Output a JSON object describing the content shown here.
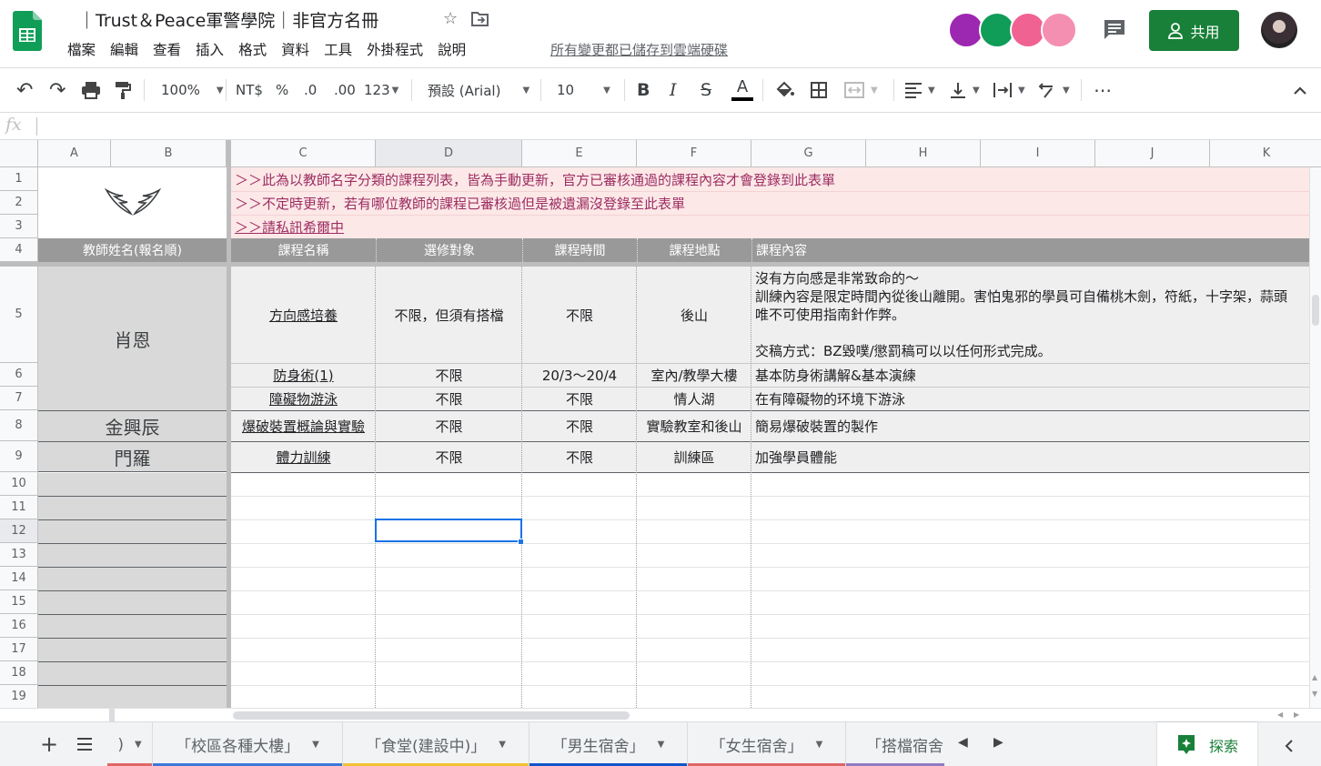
{
  "app": {
    "title": "｜Trust＆Peace軍警學院｜非官方名冊",
    "save_status": "所有變更都已儲存到雲端硬碟",
    "share_label": "共用"
  },
  "menu": [
    "檔案",
    "編輯",
    "查看",
    "插入",
    "格式",
    "資料",
    "工具",
    "外掛程式",
    "說明"
  ],
  "toolbar": {
    "zoom": "100%",
    "currency": "NT$",
    "percent": "%",
    "decrease_decimal": ".0",
    "increase_decimal": ".00",
    "number_format": "123",
    "font": "預設 (Arial)",
    "font_size": "10",
    "bold": "B",
    "italic": "I",
    "strikethrough": "S",
    "text_color": "A",
    "more": "⋯"
  },
  "formula_bar": {
    "fx_label": "fx",
    "value": ""
  },
  "columns": [
    "A",
    "B",
    "C",
    "D",
    "E",
    "F",
    "G",
    "H",
    "I",
    "J",
    "K"
  ],
  "selected_column": "D",
  "rows": [
    "1",
    "2",
    "3",
    "4",
    "5",
    "6",
    "7",
    "8",
    "9",
    "10",
    "11",
    "12",
    "13",
    "14",
    "15",
    "16",
    "17",
    "18",
    "19"
  ],
  "selected_row": "12",
  "notes": [
    "＞＞此為以教師名字分類的課程列表，皆為手動更新，官方已審核通過的課程內容才會登錄到此表單",
    "＞＞不定時更新，若有哪位教師的課程已審核過但是被遺漏沒登錄至此表單",
    "＞＞請私訊希爾中"
  ],
  "table_header": {
    "teacher": "教師姓名(報名順)",
    "course": "課程名稱",
    "target": "選修對象",
    "time": "課程時間",
    "location": "課程地點",
    "content": "課程內容"
  },
  "teachers": [
    "肖恩",
    "金興辰",
    "門羅"
  ],
  "courses": [
    {
      "name": "方向感培養",
      "target": "不限，但須有搭檔",
      "time": "不限",
      "location": "後山",
      "content": [
        "沒有方向感是非常致命的～",
        "訓練內容是限定時間內從後山離開。害怕鬼邪的學員可自備桃木劍，符紙，十字架，蒜頭",
        "唯不可使用指南針作弊。",
        "",
        "交稿方式：BZ毀噗/懲罰稿可以以任何形式完成。"
      ]
    },
    {
      "name": "防身術(1)",
      "target": "不限",
      "time": "20/3～20/4",
      "location": "室內/教學大樓",
      "content": [
        "基本防身術講解&基本演練"
      ]
    },
    {
      "name": "障礙物游泳",
      "target": "不限",
      "time": "不限",
      "location": "情人湖",
      "content": [
        "在有障礙物的环境下游泳"
      ]
    },
    {
      "name": "爆破裝置概論與實驗",
      "target": "不限",
      "time": "不限",
      "location": "實驗教室和後山",
      "content": [
        "簡易爆破裝置的製作"
      ]
    },
    {
      "name": "體力訓練",
      "target": "不限",
      "time": "不限",
      "location": "訓練區",
      "content": [
        "加強學員體能"
      ]
    }
  ],
  "sheet_tabs": [
    {
      "label": "「校區各種大樓」",
      "color": "#3d78d8"
    },
    {
      "label": "「食堂(建設中)」",
      "color": "#f1c232"
    },
    {
      "label": "「男生宿舍」",
      "color": "#1155cc"
    },
    {
      "label": "「女生宿舍」",
      "color": "#e06666"
    },
    {
      "label": "「搭檔宿舍",
      "color": "#8e7cc3"
    }
  ],
  "explore_label": "探索",
  "colors": {
    "accent_green": "#188038",
    "selection_blue": "#1a73e8",
    "note_pink": "#fde8e8",
    "header_gray": "#999999"
  }
}
